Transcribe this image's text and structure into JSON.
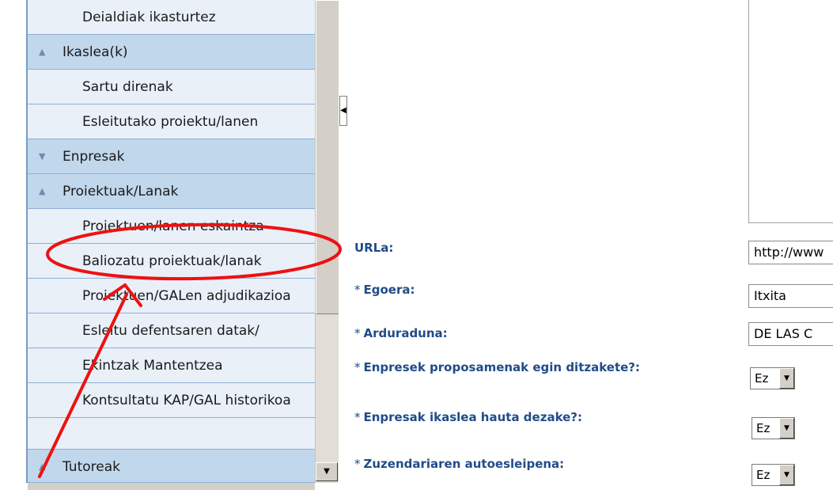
{
  "sidebar": {
    "items": [
      {
        "label": "Deialdiak ikasturtez",
        "kind": "item"
      },
      {
        "label": "Ikaslea(k)",
        "kind": "group",
        "arrow": "▲"
      },
      {
        "label": "Sartu direnak",
        "kind": "item"
      },
      {
        "label": "Esleitutako proiektu/lanen",
        "kind": "item"
      },
      {
        "label": "Enpresak",
        "kind": "group",
        "arrow": "▼"
      },
      {
        "label": "Proiektuak/Lanak",
        "kind": "group",
        "arrow": "▲"
      },
      {
        "label": "Proiektuen/lanen eskaintza",
        "kind": "item"
      },
      {
        "label": "Baliozatu proiektuak/lanak",
        "kind": "item"
      },
      {
        "label": "Proiektuen/GALen adjudikazioa",
        "kind": "item"
      },
      {
        "label": "Esleitu defentsaren datak/",
        "kind": "item"
      },
      {
        "label": "Ekintzak Mantentzea",
        "kind": "item"
      },
      {
        "label": "Kontsultatu KAP/GAL historikoa",
        "kind": "item"
      },
      {
        "label": "Tutoreak",
        "kind": "group",
        "arrow": "▲"
      }
    ]
  },
  "form": {
    "url_label": "URLa:",
    "url_value": "http://www",
    "egoera_label": "Egoera:",
    "egoera_value": "Itxita",
    "arduraduna_label": "Arduraduna:",
    "arduraduna_value": "DE LAS C",
    "enpresek_label": "Enpresek proposamenak egin ditzakete?:",
    "enpresek_value": "Ez",
    "hauta_label": "Enpresak ikaslea hauta dezake?:",
    "hauta_value": "Ez",
    "zuzendari_label": "Zuzendariaren autoesleipena:",
    "zuzendari_value": "Ez",
    "required_mark": "*"
  },
  "icons": {
    "expand_up": "▲",
    "expand_down": "▼",
    "scroll_down": "▼",
    "collapse_left": "◀",
    "select_arrow": "▼"
  },
  "colors": {
    "menu_group": "#c1d7ec",
    "menu_item": "#e9f0f8",
    "label_blue": "#204c88",
    "annotation_red": "#ee1111"
  }
}
